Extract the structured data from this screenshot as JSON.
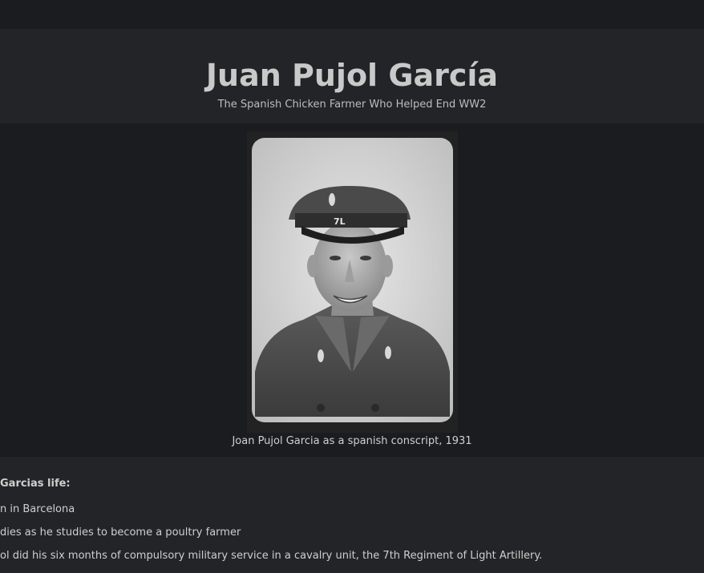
{
  "header": {
    "title": "Juan Pujol García",
    "subtitle": "The Spanish Chicken Farmer Who Helped End WW2"
  },
  "hero": {
    "caption": "Joan Pujol Garcia as a spanish conscript, 1931",
    "cap_badge_text": "7L"
  },
  "timeline": {
    "title": "Garcias life:",
    "items": [
      "n in Barcelona",
      "dies as he studies to become a poultry farmer",
      "ol did his six months of compulsory military service in a cavalry unit, the 7th Regiment of Light Artillery."
    ]
  }
}
